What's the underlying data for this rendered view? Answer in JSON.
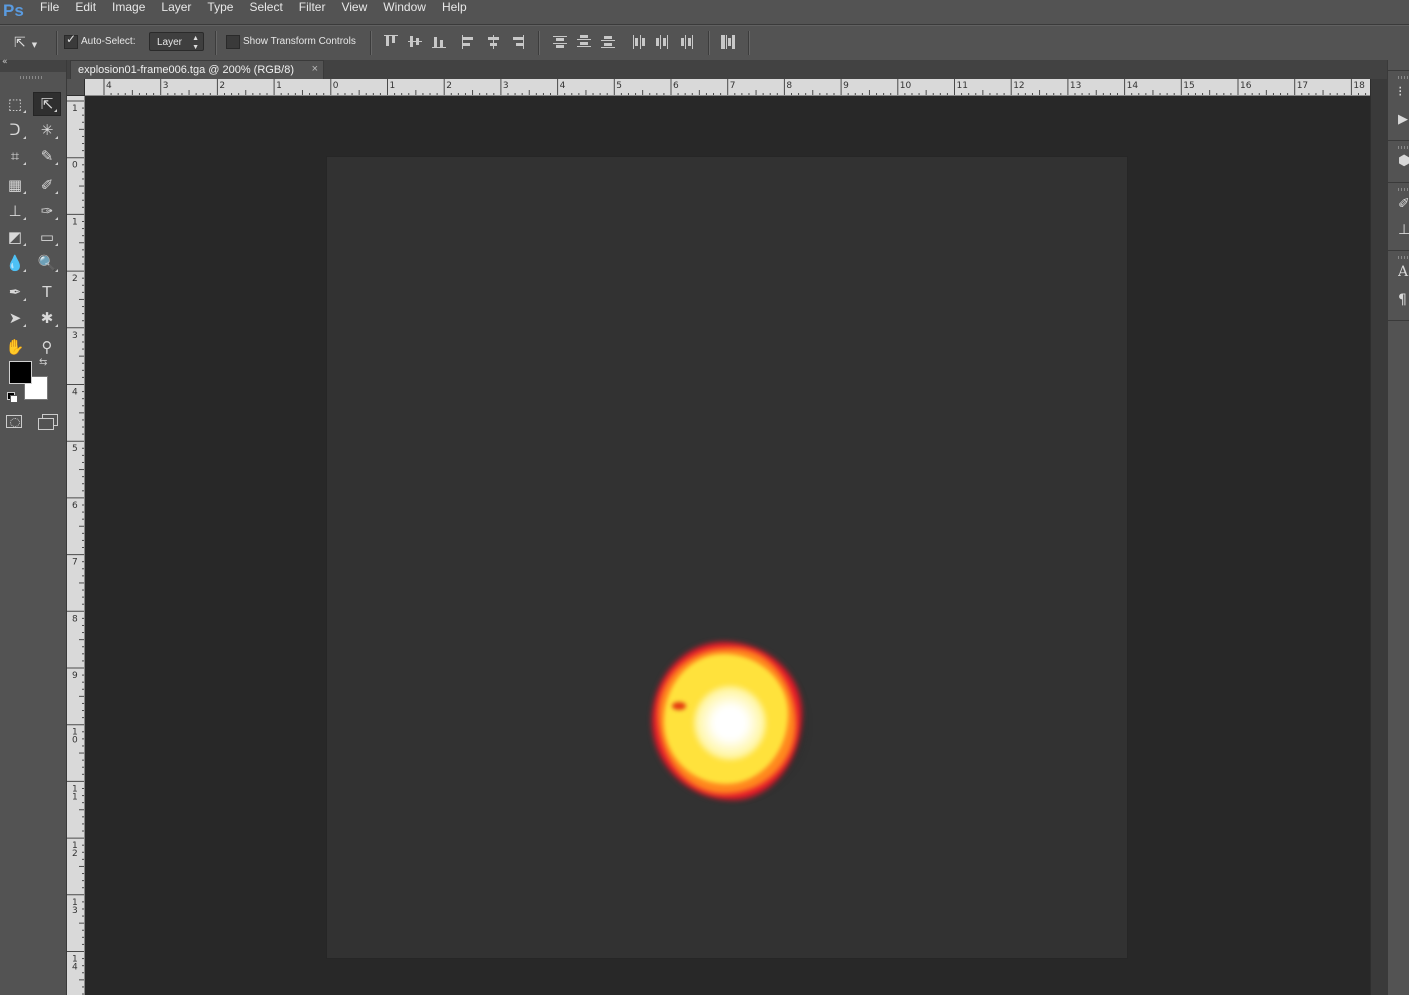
{
  "app": {
    "logo": "Ps"
  },
  "menu": [
    "File",
    "Edit",
    "Image",
    "Layer",
    "Type",
    "Select",
    "Filter",
    "View",
    "Window",
    "Help"
  ],
  "options_bar": {
    "auto_select_label": "Auto-Select:",
    "auto_select_checked": true,
    "auto_select_target": "Layer",
    "show_transform_label": "Show Transform Controls",
    "show_transform_checked": false
  },
  "document": {
    "tab_title": "explosion01-frame006.tga @ 200% (RGB/8)",
    "close_glyph": "×"
  },
  "rulers": {
    "horizontal_labels": [
      "4",
      "3",
      "2",
      "1",
      "0",
      "1",
      "2",
      "3",
      "4",
      "5",
      "6",
      "7",
      "8",
      "9",
      "10",
      "11",
      "12",
      "13",
      "14",
      "15",
      "16",
      "17",
      "18"
    ],
    "vertical_labels": [
      "1",
      "0",
      "1",
      "2",
      "3",
      "4",
      "5",
      "6",
      "7",
      "8",
      "9",
      "10",
      "11",
      "12",
      "13",
      "14"
    ]
  },
  "tools": [
    {
      "name": "rectangular-marquee-tool-icon",
      "glyph": "⬚"
    },
    {
      "name": "move-tool-icon",
      "glyph": "⇱",
      "active": true
    },
    {
      "name": "lasso-tool-icon",
      "glyph": "ᑐ"
    },
    {
      "name": "magic-wand-tool-icon",
      "glyph": "✳"
    },
    {
      "name": "crop-tool-icon",
      "glyph": "⌗"
    },
    {
      "name": "eyedropper-tool-icon",
      "glyph": "✎"
    },
    {
      "name": "spot-healing-tool-icon",
      "glyph": "▦"
    },
    {
      "name": "brush-tool-icon",
      "glyph": "✐"
    },
    {
      "name": "clone-stamp-tool-icon",
      "glyph": "⊥"
    },
    {
      "name": "history-brush-tool-icon",
      "glyph": "✑"
    },
    {
      "name": "eraser-tool-icon",
      "glyph": "◩"
    },
    {
      "name": "gradient-tool-icon",
      "glyph": "▭"
    },
    {
      "name": "blur-tool-icon",
      "glyph": "💧"
    },
    {
      "name": "dodge-tool-icon",
      "glyph": "🔍"
    },
    {
      "name": "pen-tool-icon",
      "glyph": "✒"
    },
    {
      "name": "type-tool-icon",
      "glyph": "T"
    },
    {
      "name": "path-selection-tool-icon",
      "glyph": "➤"
    },
    {
      "name": "custom-shape-tool-icon",
      "glyph": "✱"
    },
    {
      "name": "hand-tool-icon",
      "glyph": "✋"
    },
    {
      "name": "zoom-tool-icon",
      "glyph": "⚲"
    }
  ],
  "colors": {
    "foreground": "#000000",
    "background": "#ffffff",
    "ui_panel": "#535353",
    "workspace": "#282828",
    "canvas": "#323232"
  },
  "right_panel_icons": [
    "history-icon",
    "play-actions-icon",
    "3d-icon",
    "brush-settings-icon",
    "clone-source-icon",
    "character-icon",
    "paragraph-icon"
  ]
}
